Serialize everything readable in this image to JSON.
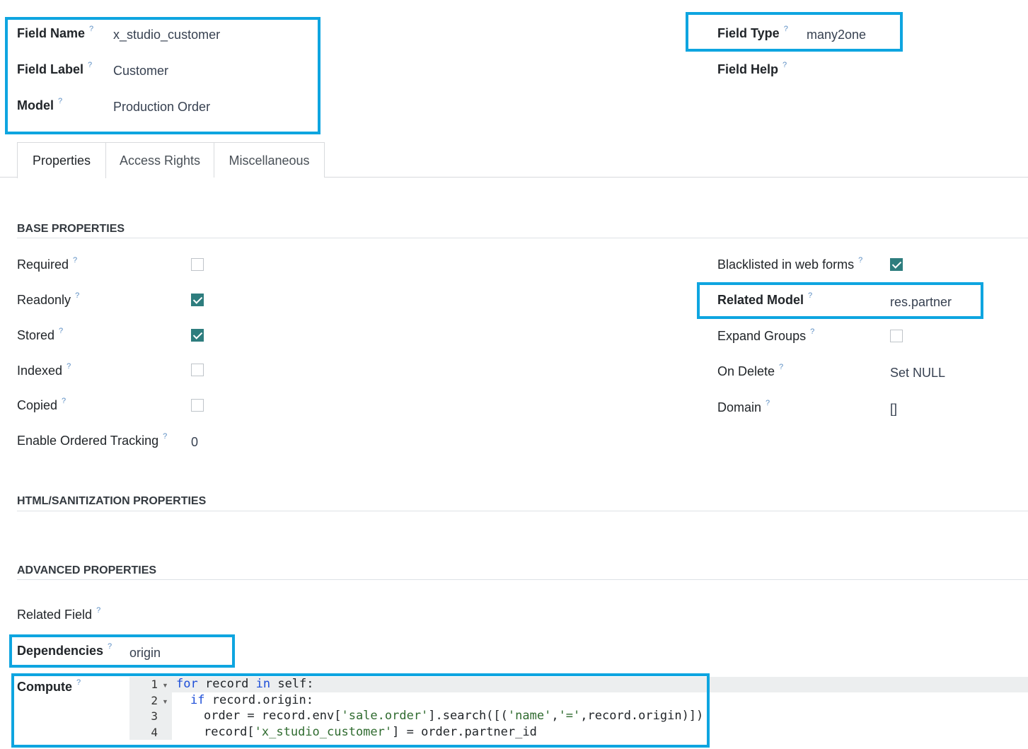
{
  "header": {
    "field_name": {
      "label": "Field Name",
      "value": "x_studio_customer"
    },
    "field_label": {
      "label": "Field Label",
      "value": "Customer"
    },
    "model": {
      "label": "Model",
      "value": "Production Order"
    },
    "field_type": {
      "label": "Field Type",
      "value": "many2one"
    },
    "field_help": {
      "label": "Field Help"
    },
    "help_mark": "?"
  },
  "tabs": [
    {
      "label": "Properties",
      "active": true
    },
    {
      "label": "Access Rights",
      "active": false
    },
    {
      "label": "Miscellaneous",
      "active": false
    }
  ],
  "base": {
    "title": "BASE PROPERTIES",
    "required": {
      "label": "Required",
      "checked": false
    },
    "readonly": {
      "label": "Readonly",
      "checked": true
    },
    "stored": {
      "label": "Stored",
      "checked": true
    },
    "indexed": {
      "label": "Indexed",
      "checked": false
    },
    "copied": {
      "label": "Copied",
      "checked": false
    },
    "tracking": {
      "label": "Enable Ordered Tracking",
      "value": "0"
    },
    "blacklisted": {
      "label": "Blacklisted in web forms",
      "checked": true
    },
    "related_model": {
      "label": "Related Model",
      "value": "res.partner"
    },
    "expand_groups": {
      "label": "Expand Groups",
      "checked": false
    },
    "on_delete": {
      "label": "On Delete",
      "value": "Set NULL"
    },
    "domain": {
      "label": "Domain",
      "value": "[]"
    }
  },
  "html_section": {
    "title": "HTML/SANITIZATION PROPERTIES"
  },
  "advanced": {
    "title": "ADVANCED PROPERTIES",
    "related_field": {
      "label": "Related Field"
    },
    "dependencies": {
      "label": "Dependencies",
      "value": "origin"
    },
    "compute": {
      "label": "Compute",
      "line_numbers": [
        "1",
        "2",
        "3",
        "4"
      ],
      "lines": [
        {
          "p1": "for",
          "p2": " record ",
          "p3": "in",
          "p4": " self:"
        },
        {
          "p1": "if",
          "p2": " record.origin:"
        },
        {
          "p1": "order = record.env[",
          "p2": "'sale.order'",
          "p3": "].search([(",
          "p4": "'name'",
          "p5": ",",
          "p6": "'='",
          "p7": ",record.origin)])"
        },
        {
          "p1": "record[",
          "p2": "'x_studio_customer'",
          "p3": "] = order.partner_id"
        }
      ]
    }
  },
  "colors": {
    "highlight": "#0ea5e0",
    "checkbox_on": "#2e7d7e"
  }
}
